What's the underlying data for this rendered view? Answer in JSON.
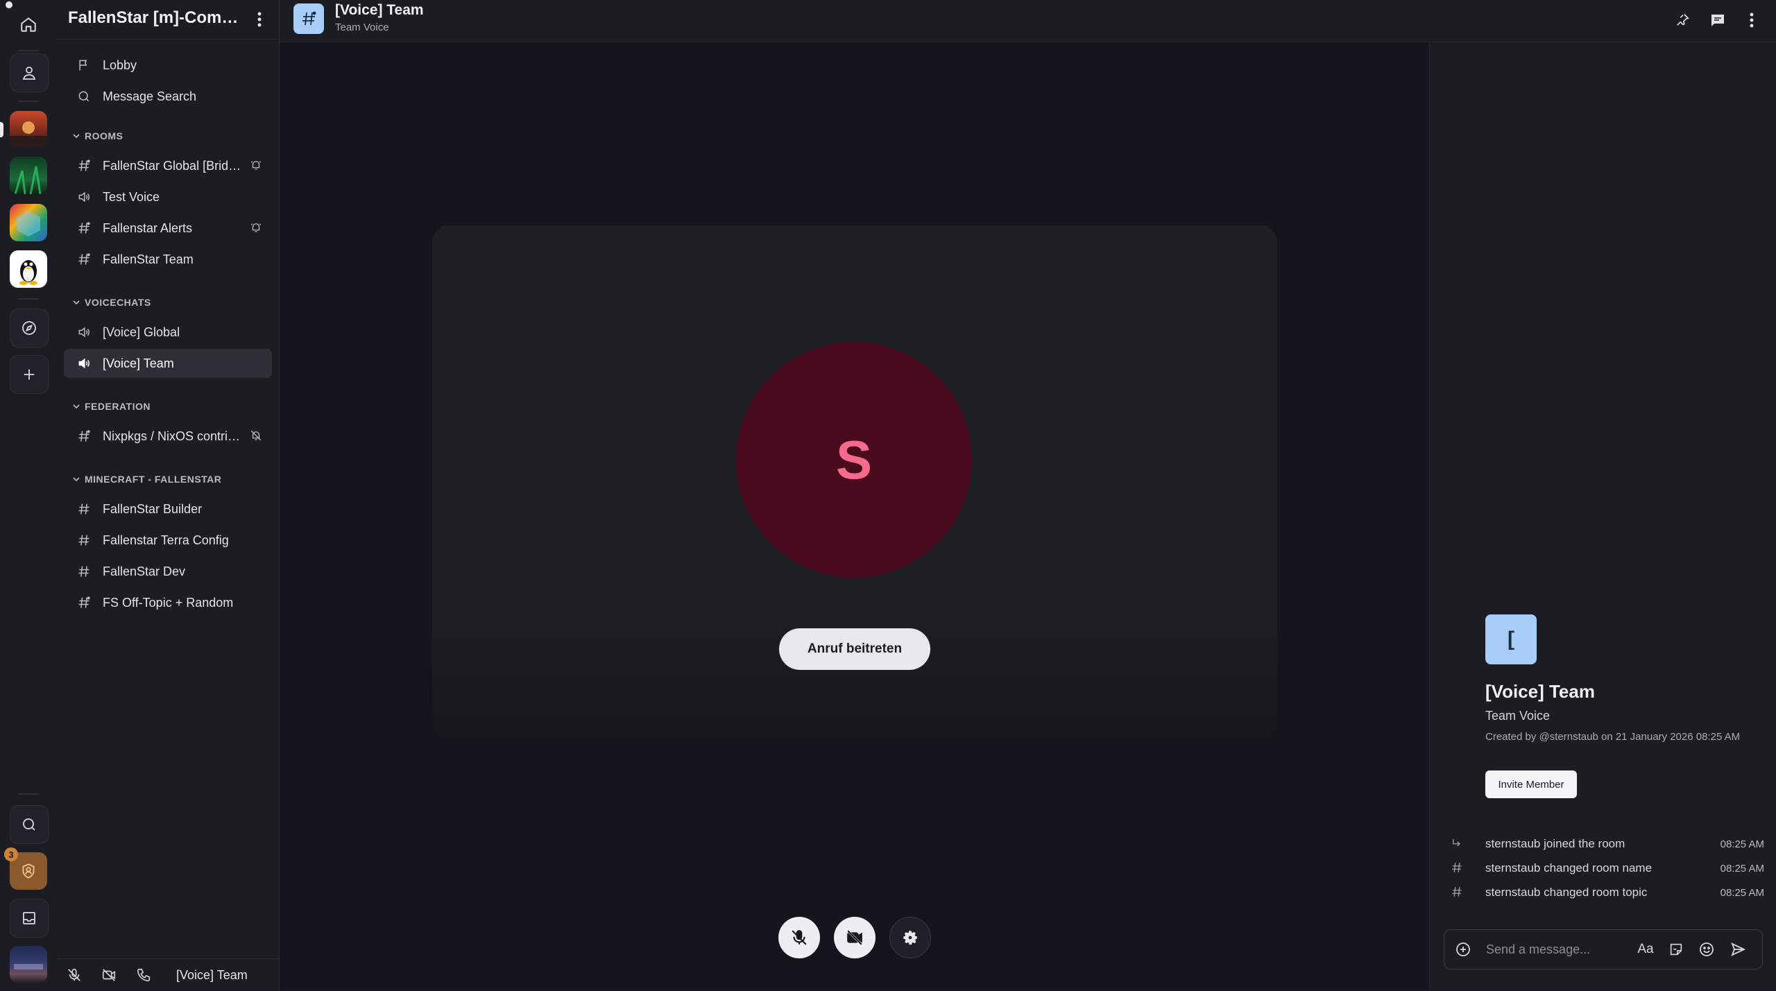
{
  "rail": {
    "home": "home-icon",
    "people": "user-icon",
    "explore": "compass-icon",
    "create": "plus-icon",
    "search": "search-icon",
    "notifications_badge": "3",
    "inbox": "inbox-icon"
  },
  "space": {
    "title": "FallenStar [m]-Community",
    "lobby_label": "Lobby",
    "search_label": "Message Search",
    "categories": [
      {
        "name": "ROOMS",
        "items": [
          {
            "label": "FallenStar Global [Bridged]",
            "icon": "hash-icon"
          },
          {
            "label": "Test Voice",
            "icon": "speaker-icon"
          },
          {
            "label": "Fallenstar Alerts",
            "icon": "hash-icon"
          },
          {
            "label": "FallenStar Team",
            "icon": "hash-icon"
          }
        ]
      },
      {
        "name": "VOICECHATS",
        "items": [
          {
            "label": "[Voice] Global",
            "icon": "speaker-icon"
          },
          {
            "label": "[Voice] Team",
            "icon": "speaker-icon",
            "active": true
          }
        ]
      },
      {
        "name": "FEDERATION",
        "items": [
          {
            "label": "Nixpkgs / NixOS contributors",
            "icon": "hash-icon"
          }
        ]
      },
      {
        "name": "MINECRAFT - FALLENSTAR",
        "items": [
          {
            "label": "FallenStar Builder",
            "icon": "hash-icon"
          },
          {
            "label": "Fallenstar Terra Config",
            "icon": "hash-icon"
          },
          {
            "label": "FallenStar Dev",
            "icon": "hash-icon"
          },
          {
            "label": "FS Off-Topic + Random",
            "icon": "hash-icon"
          }
        ]
      }
    ],
    "footer_room": "[Voice] Team"
  },
  "header": {
    "room_name": "[Voice] Team",
    "room_topic": "Team Voice"
  },
  "call": {
    "participant_initial": "S",
    "join_label": "Anruf beitreten"
  },
  "room_info": {
    "avatar_initial": "[",
    "name": "[Voice] Team",
    "topic": "Team Voice",
    "created": "Created by @sternstaub on 21 January 2026 08:25 AM",
    "invite_label": "Invite Member",
    "events": [
      {
        "text": "sternstaub joined the room",
        "time": "08:25 AM",
        "icon": "arrow-join-icon"
      },
      {
        "text": "sternstaub changed room name",
        "time": "08:25 AM",
        "icon": "hash-icon"
      },
      {
        "text": "sternstaub changed room topic",
        "time": "08:25 AM",
        "icon": "hash-icon"
      }
    ],
    "composer_placeholder": "Send a message..."
  },
  "colors": {
    "accent_avatar": "#a8cdf7",
    "participant_bg": "#4a0b1e",
    "participant_fg": "#f56a8d"
  }
}
